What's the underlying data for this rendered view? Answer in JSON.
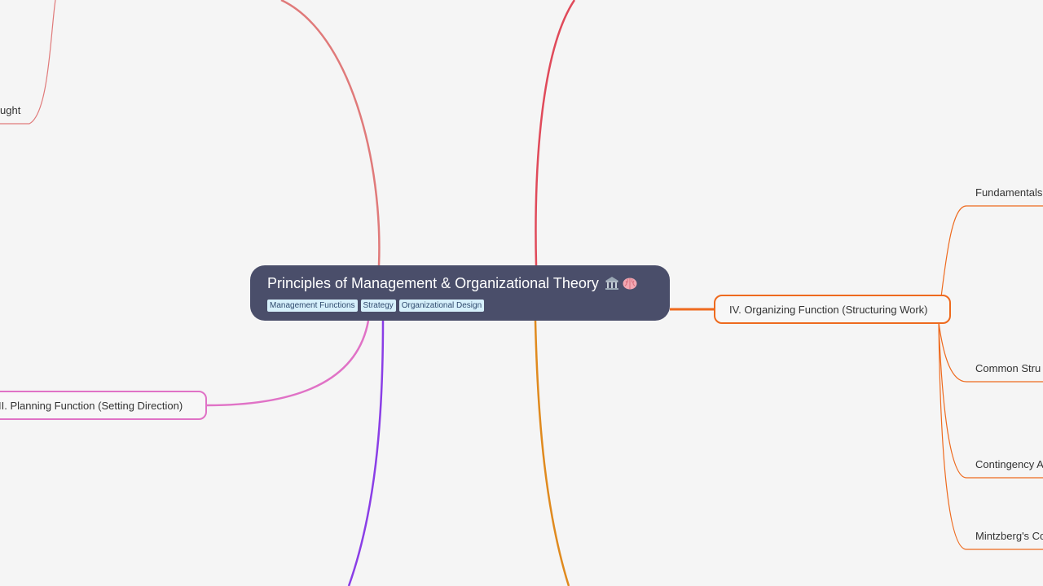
{
  "root": {
    "title": "Principles of Management & Organizational Theory",
    "icons": [
      "classical-building-icon",
      "brain-icon"
    ],
    "tags": [
      "Management Functions",
      "Strategy",
      "Organizational Design"
    ]
  },
  "branches": {
    "organizing": {
      "label": "IV. Organizing Function (Structuring Work)",
      "color": "#ee6a1e",
      "children": [
        "Fundamentals",
        "Common Stru",
        "Contingency A",
        "Mintzberg's Co"
      ]
    },
    "planning": {
      "label": "II. Planning Function (Setting Direction)",
      "color": "#e072c6"
    },
    "thought": {
      "label": "ught",
      "color": "#e07a7a"
    }
  },
  "colors": {
    "background": "#f5f5f5",
    "root_fill": "#4a4e6a",
    "tag_fill": "#d6f0fb",
    "edge_red": "#e04a5a",
    "edge_salmon": "#e07a7a",
    "edge_purple": "#8a3ee6",
    "edge_amber": "#e08a1e"
  }
}
